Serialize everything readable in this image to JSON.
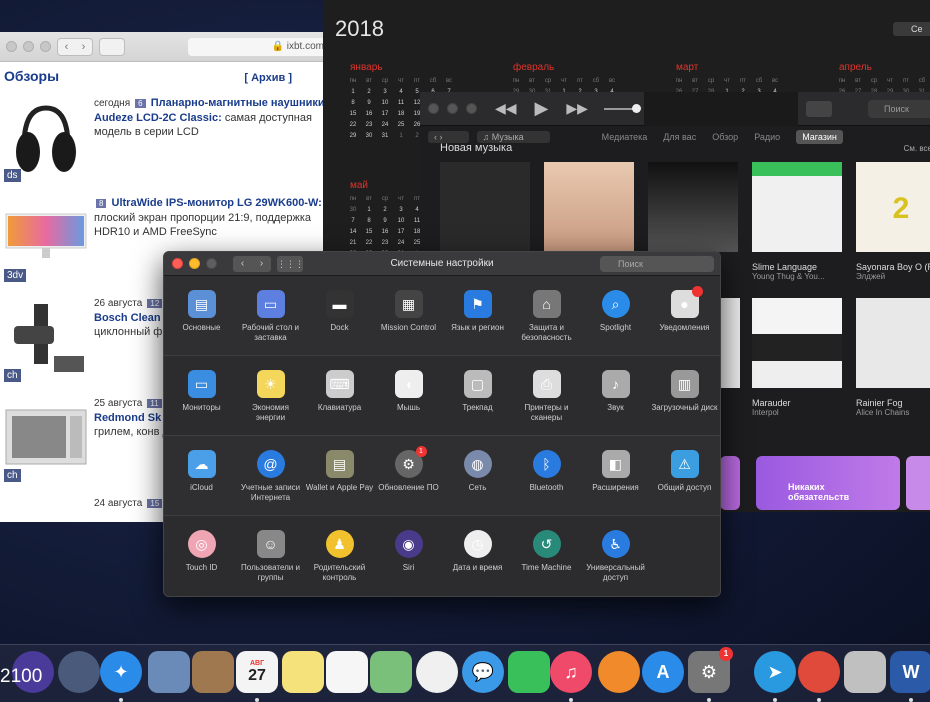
{
  "safari": {
    "url": "ixbt.com",
    "section_title": "Обзоры",
    "archive_link": "[ Архив ]",
    "articles": [
      {
        "tag": "ds",
        "date": "сегодня",
        "num": "6",
        "title": "Планарно-магнитные наушники Audeze LCD-2C Classic:",
        "desc": "самая доступная модель в серии LCD"
      },
      {
        "tag": "3dv",
        "date": "",
        "num": "8",
        "title": "UltraWide IPS-монитор LG 29WK600-W:",
        "desc": "плоский экран пропорции 21:9, поддержка HDR10 и AMD FreeSync"
      },
      {
        "tag": "ch",
        "date": "26 августа",
        "num": "12",
        "title": "Bosch Clean",
        "desc": "циклонный ф компактное"
      },
      {
        "tag": "ch",
        "date": "25 августа",
        "num": "11",
        "title": "Redmond Sk",
        "desc": "грилем, конв дистанционн"
      },
      {
        "tag": "",
        "date": "24 августа",
        "num": "15",
        "title": "",
        "desc": ""
      }
    ]
  },
  "calendar": {
    "year": "2018",
    "top_button": "Се",
    "months": [
      "январь",
      "февраль",
      "март",
      "апрель",
      "май"
    ],
    "weekdays": [
      "пн",
      "вт",
      "ср",
      "чт",
      "пт",
      "сб",
      "вс"
    ]
  },
  "itunes": {
    "search_placeholder": "Поиск",
    "source_selector": "Музыка",
    "tabs": [
      "Медиатека",
      "Для вас",
      "Обзор",
      "Радио",
      "Магазин"
    ],
    "active_tab": "Магазин",
    "section_title": "Новая музыка",
    "see_all": "См. все",
    "albums": [
      {
        "title": "",
        "artist": ""
      },
      {
        "title": "",
        "artist": ""
      },
      {
        "title": "",
        "artist": ""
      },
      {
        "title": "Slime Language",
        "artist": "Young Thug & You..."
      },
      {
        "title": "Sayonara Boy O (Remix)",
        "artist": "Элджей"
      },
      {
        "title": "Marauder",
        "artist": "Interpol"
      },
      {
        "title": "Rainier Fog",
        "artist": "Alice In Chains"
      }
    ],
    "promo_text": "Никаких обязательств"
  },
  "prefs": {
    "title": "Системные настройки",
    "search_placeholder": "Поиск",
    "rows": [
      [
        {
          "label": "Основные",
          "icon": "general-icon",
          "color": "#5b8fd6"
        },
        {
          "label": "Рабочий стол и заставка",
          "icon": "desktop-icon",
          "color": "#5d7fe0"
        },
        {
          "label": "Dock",
          "icon": "dock-icon",
          "color": "#333333"
        },
        {
          "label": "Mission Control",
          "icon": "mission-control-icon",
          "color": "#444444"
        },
        {
          "label": "Язык и регион",
          "icon": "language-flag-icon",
          "color": "#2a7be0"
        },
        {
          "label": "Защита и безопасность",
          "icon": "house-lock-icon",
          "color": "#777777"
        },
        {
          "label": "Spotlight",
          "icon": "spotlight-icon",
          "color": "#2a8be8"
        },
        {
          "label": "Уведомления",
          "icon": "notifications-icon",
          "color": "#dddddd"
        }
      ],
      [
        {
          "label": "Мониторы",
          "icon": "monitor-icon",
          "color": "#3a8de0"
        },
        {
          "label": "Экономия энергии",
          "icon": "bulb-icon",
          "color": "#f3d65a"
        },
        {
          "label": "Клавиатура",
          "icon": "keyboard-icon",
          "color": "#cccccc"
        },
        {
          "label": "Мышь",
          "icon": "mouse-icon",
          "color": "#eeeeee"
        },
        {
          "label": "Трекпад",
          "icon": "trackpad-icon",
          "color": "#bbbbbb"
        },
        {
          "label": "Принтеры и сканеры",
          "icon": "printer-icon",
          "color": "#dddddd"
        },
        {
          "label": "Звук",
          "icon": "speaker-icon",
          "color": "#aaaaaa"
        },
        {
          "label": "Загрузочный диск",
          "icon": "disk-icon",
          "color": "#999999"
        }
      ],
      [
        {
          "label": "iCloud",
          "icon": "icloud-icon",
          "color": "#4a9fe8"
        },
        {
          "label": "Учетные записи Интернета",
          "icon": "at-icon",
          "color": "#2a7be0"
        },
        {
          "label": "Wallet и Apple Pay",
          "icon": "wallet-icon",
          "color": "#8a8a6a"
        },
        {
          "label": "Обновление ПО",
          "icon": "software-update-icon",
          "color": "#666666",
          "badge": "1"
        },
        {
          "label": "Сеть",
          "icon": "network-globe-icon",
          "color": "#7a8aaa"
        },
        {
          "label": "Bluetooth",
          "icon": "bluetooth-icon",
          "color": "#2a7be0"
        },
        {
          "label": "Расширения",
          "icon": "extensions-puzzle-icon",
          "color": "#aaaaaa"
        },
        {
          "label": "Общий доступ",
          "icon": "sharing-folder-icon",
          "color": "#3a9ee0"
        }
      ],
      [
        {
          "label": "Touch ID",
          "icon": "fingerprint-icon",
          "color": "#f0a5b5"
        },
        {
          "label": "Пользователи и группы",
          "icon": "users-icon",
          "color": "#888888"
        },
        {
          "label": "Родительский контроль",
          "icon": "parental-control-icon",
          "color": "#f2c12e"
        },
        {
          "label": "Siri",
          "icon": "siri-icon",
          "color": "#4a3a8a"
        },
        {
          "label": "Дата и время",
          "icon": "clock-icon",
          "color": "#eeeeee"
        },
        {
          "label": "Time Machine",
          "icon": "time-machine-icon",
          "color": "#2a8a7a"
        },
        {
          "label": "Универсальный доступ",
          "icon": "accessibility-icon",
          "color": "#2a7be0"
        }
      ]
    ]
  },
  "dock": {
    "clock_text": "2100",
    "calendar_day": "27",
    "calendar_month": "АВГ",
    "prefs_badge": "1",
    "word_letter": "W",
    "items": [
      {
        "name": "siri-dock-icon",
        "color": "#4a3a9a",
        "round": true,
        "dot": false
      },
      {
        "name": "launchpad-dock-icon",
        "color": "#4a5a7a",
        "round": true,
        "dot": false
      },
      {
        "name": "safari-dock-icon",
        "color": "#2a8be8",
        "round": true,
        "dot": true
      },
      {
        "name": "preview-dock-icon",
        "color": "#6a8ab8",
        "round": false,
        "dot": false
      },
      {
        "name": "contacts-dock-icon",
        "color": "#a07850",
        "round": false,
        "dot": false
      },
      {
        "name": "calendar-dock-icon",
        "color": "#f4f4f4",
        "round": false,
        "dot": true
      },
      {
        "name": "notes-dock-icon",
        "color": "#f6e27a",
        "round": false,
        "dot": false
      },
      {
        "name": "reminders-dock-icon",
        "color": "#f6f6f6",
        "round": false,
        "dot": false
      },
      {
        "name": "maps-dock-icon",
        "color": "#7ac07a",
        "round": false,
        "dot": false
      },
      {
        "name": "photos-dock-icon",
        "color": "#f0f0f0",
        "round": true,
        "dot": false
      },
      {
        "name": "messages-dock-icon",
        "color": "#3a9ae8",
        "round": true,
        "dot": false
      },
      {
        "name": "facetime-dock-icon",
        "color": "#3ac05a",
        "round": false,
        "dot": false
      },
      {
        "name": "itunes-dock-icon",
        "color": "#f04a6a",
        "round": true,
        "dot": true
      },
      {
        "name": "books-dock-icon",
        "color": "#f08a2a",
        "round": true,
        "dot": false
      },
      {
        "name": "app-store-dock-icon",
        "color": "#2a8be8",
        "round": true,
        "dot": false
      },
      {
        "name": "system-prefs-dock-icon",
        "color": "#777777",
        "round": false,
        "dot": true
      },
      {
        "name": "telegram-dock-icon",
        "color": "#2a9ae0",
        "round": true,
        "dot": true
      },
      {
        "name": "chrome-dock-icon",
        "color": "#e04a3a",
        "round": true,
        "dot": true
      },
      {
        "name": "mail-stamp-dock-icon",
        "color": "#c0c0c0",
        "round": false,
        "dot": false
      },
      {
        "name": "word-dock-icon",
        "color": "#2a5aa8",
        "round": false,
        "dot": true
      }
    ]
  }
}
